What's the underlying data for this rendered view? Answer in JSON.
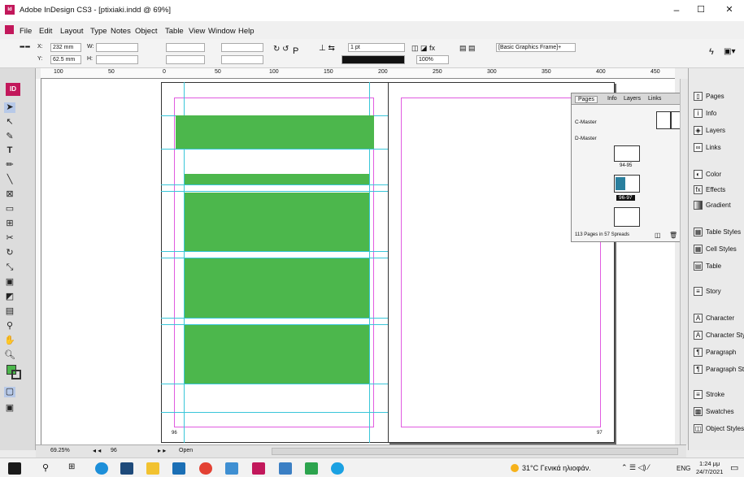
{
  "window": {
    "title": "Adobe InDesign CS3 - [ptixiaki.indd @ 69%]"
  },
  "menu": [
    "File",
    "Edit",
    "Layout",
    "Type",
    "Notes",
    "Object",
    "Table",
    "View",
    "Window",
    "Help"
  ],
  "control": {
    "x": "232 mm",
    "y": "62.5 mm",
    "x_label": "X:",
    "y_label": "Y:",
    "w_label": "W:",
    "h_label": "H:",
    "stroke_weight": "1 pt",
    "opacity": "100%",
    "style": "[Basic Graphics Frame]+"
  },
  "ruler": [
    "100",
    "50",
    "0",
    "50",
    "100",
    "150",
    "200",
    "250",
    "300",
    "350",
    "400",
    "450"
  ],
  "document": {
    "left_page_number": "96",
    "right_page_number": "97"
  },
  "pages_panel": {
    "tabs": [
      "Pages",
      "Info",
      "Layers",
      "Links"
    ],
    "masters": [
      "C-Master",
      "D-Master"
    ],
    "spreads": [
      "94-95",
      "96-97"
    ],
    "footer": "113 Pages in 57 Spreads"
  },
  "right_panel": [
    "Pages",
    "Info",
    "Layers",
    "Links",
    "Color",
    "Effects",
    "Gradient",
    "Table Styles",
    "Cell Styles",
    "Table",
    "Story",
    "Character",
    "Character Styles",
    "Paragraph",
    "Paragraph Styles",
    "Stroke",
    "Swatches",
    "Object Styles"
  ],
  "status": {
    "zoom": "69.25%",
    "page": "96",
    "open": "Open"
  },
  "taskbar": {
    "weather": "31°C Γενικά ηλιοφάν.",
    "lang": "ENG",
    "time": "1:24 μμ",
    "date": "24/7/2021"
  }
}
